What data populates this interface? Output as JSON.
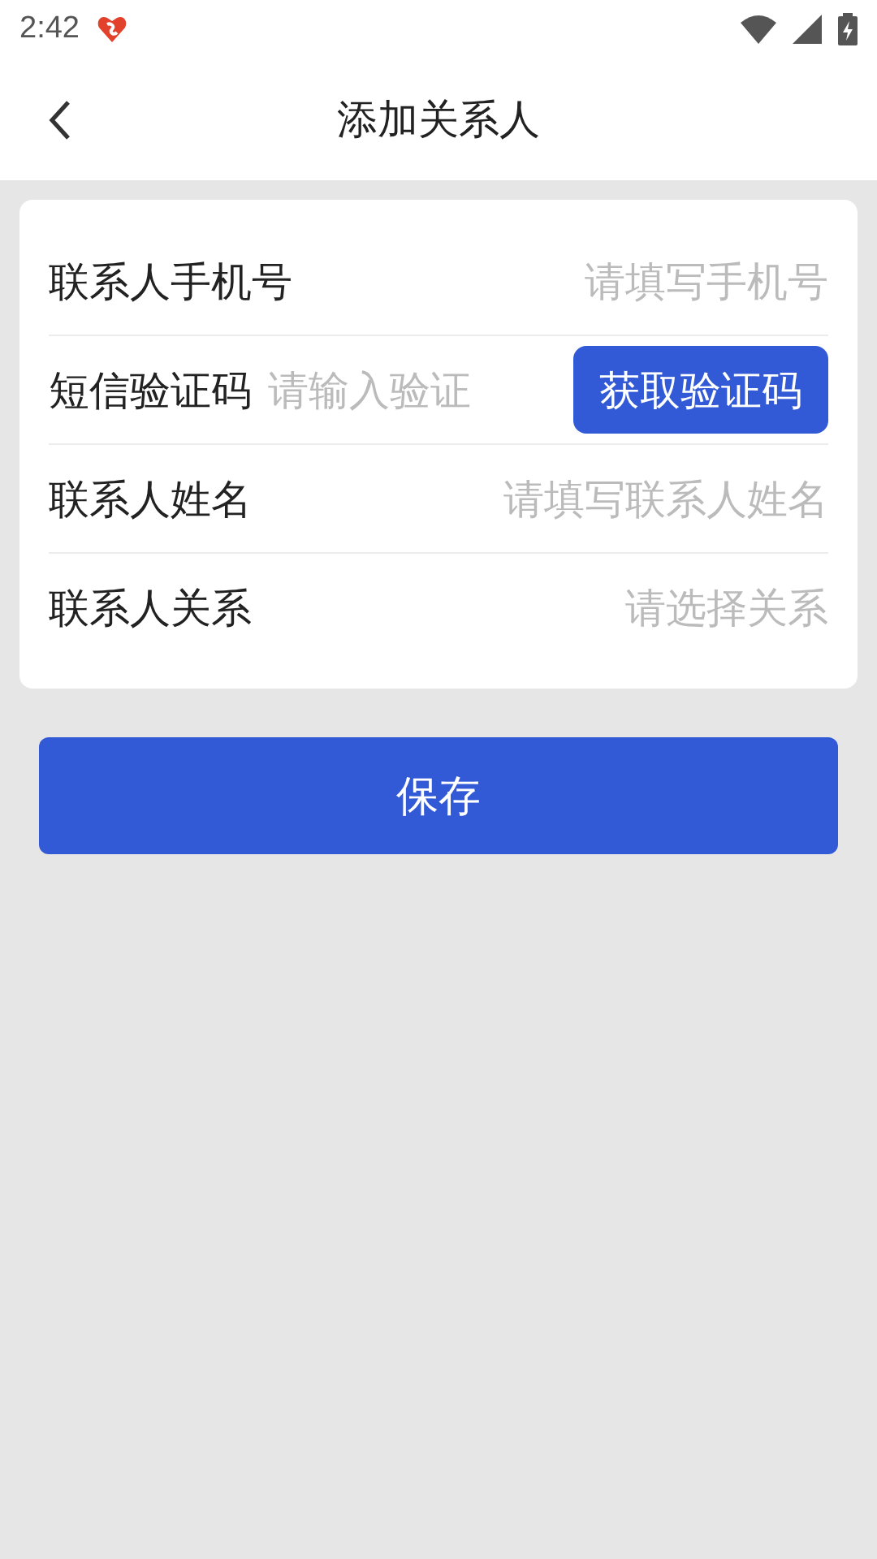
{
  "status_bar": {
    "time": "2:42"
  },
  "header": {
    "title": "添加关系人"
  },
  "form": {
    "rows": [
      {
        "kind": "input",
        "label": "联系人手机号",
        "placeholder": "请填写手机号"
      },
      {
        "kind": "code",
        "label": "短信验证码",
        "placeholder": "请输入验证",
        "button": "获取验证码"
      },
      {
        "kind": "input",
        "label": "联系人姓名",
        "placeholder": "请填写联系人姓名"
      },
      {
        "kind": "select",
        "label": "联系人关系",
        "placeholder": "请选择关系"
      }
    ]
  },
  "save_button": "保存"
}
